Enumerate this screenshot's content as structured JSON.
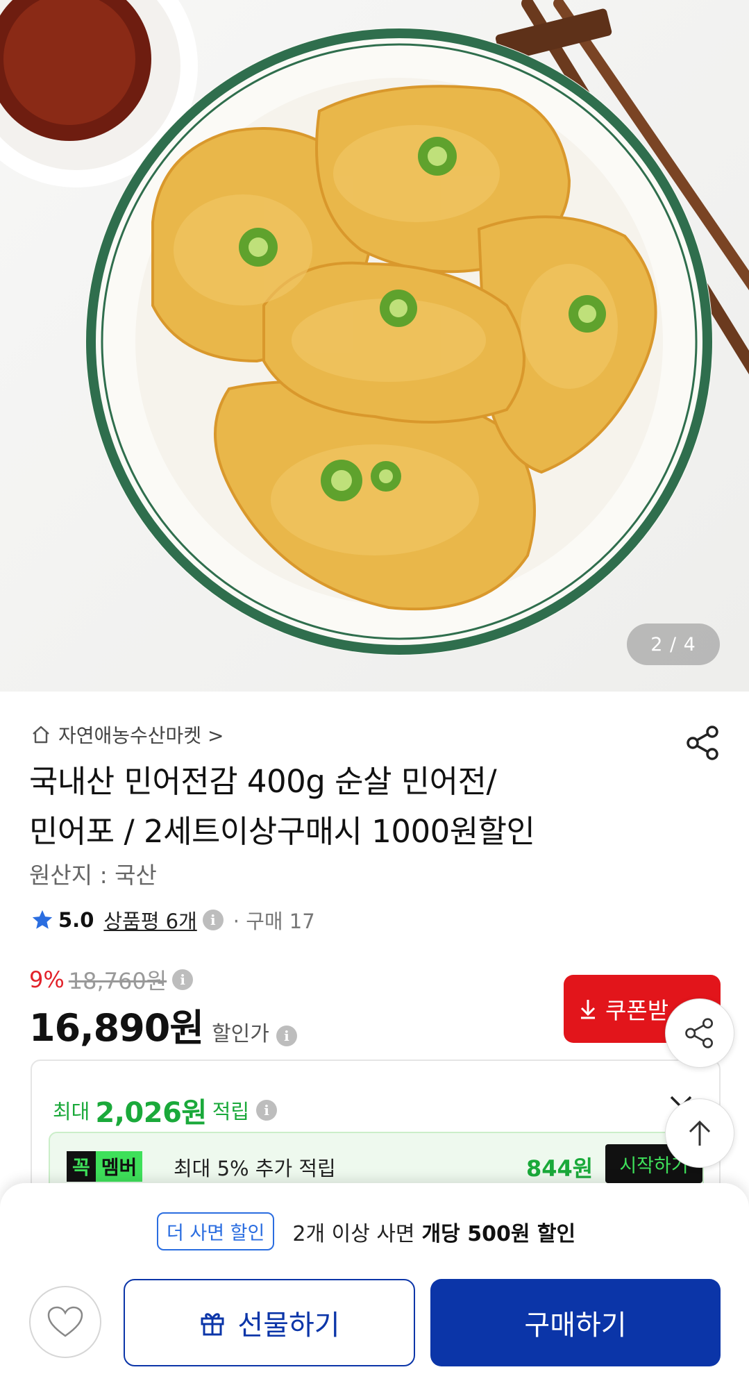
{
  "hero": {
    "image_description_icon": "fried-fish-pancake-photo",
    "counter": "2 / 4"
  },
  "seller": {
    "name": "자연애농수산마켓 >",
    "icon": "home-icon"
  },
  "product": {
    "title_line1": "국내산 민어전감 400g 순살 민어전/",
    "title_line2": "민어포 / 2세트이상구매시 1000원할인",
    "origin": "원산지 : 국산"
  },
  "rating": {
    "score": "5.0",
    "reviews": "상품평 6개",
    "purchases": "· 구매 17"
  },
  "price": {
    "discount_pct": "9%",
    "original": "18,760원",
    "sale": "16,890원",
    "sale_label": "할인가"
  },
  "coupon": {
    "label": "쿠폰받"
  },
  "points": {
    "prefix": "최대",
    "amount": "2,026원",
    "suffix": "적립",
    "member_badge_1": "꼭",
    "member_badge_2": "멤버",
    "member_text": "최대 5% 추가 적립",
    "member_amount": "844원",
    "member_start": "시작하기"
  },
  "bulk": {
    "tag": "더 사면 할인",
    "text": "2개 이상 사면",
    "bold": "개당 500원 할인"
  },
  "actions": {
    "gift": "선물하기",
    "buy": "구매하기"
  },
  "colors": {
    "accent_blue": "#0b35a8",
    "sale_red": "#e2222a",
    "point_green": "#1aa93a"
  }
}
